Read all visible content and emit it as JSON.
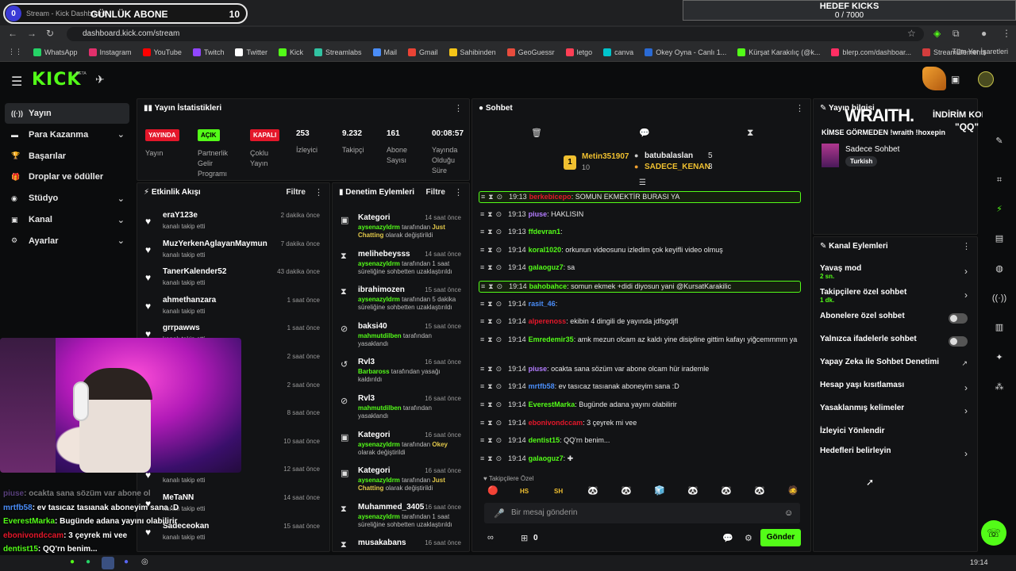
{
  "overlay": {
    "goal_count_left": "0",
    "goal_title": "GÜNLÜK ABONE",
    "goal_count": "10",
    "browser_tab": "Stream - Kick Dashboard",
    "kicks_title": "HEDEF KICKS",
    "kicks_value": "0 / 7000",
    "sponsor_brand": "WRAITH.",
    "sponsor_discount": "İNDİRİM KODU",
    "sponsor_code": "\"QQ\"",
    "sponsor_line": "KİMSE GÖRMEDEN !wraith !hoxepin"
  },
  "browser": {
    "url": "dashboard.kick.com/stream",
    "bookmarks": [
      "WhatsApp",
      "Instagram",
      "YouTube",
      "Twitch",
      "Twitter",
      "Kick",
      "Streamlabs",
      "Mail",
      "Gmail",
      "Sahibinden",
      "GeoGuessr",
      "letgo",
      "canva",
      "Okey Oyna - Canlı 1...",
      "Kürşat Karakılıç (@k...",
      "blerp.com/dashboar...",
      "StreamElements"
    ],
    "bookmarks_right": "Tüm Yer İşaretleri",
    "bookmark_colors": [
      "#25d366",
      "#e1306c",
      "#ff0000",
      "#9146ff",
      "#ffffff",
      "#53fc18",
      "#31c3a2",
      "#4a8df8",
      "#ea4335",
      "#f5c518",
      "#e84c3d",
      "#ff3f55",
      "#00c4cc",
      "#2a6ad4",
      "#53fc18",
      "#ff2e63",
      "#d43d3d"
    ]
  },
  "header": {
    "logo": "KICK",
    "beta": "BETA"
  },
  "sidebar": {
    "items": [
      {
        "label": "Yayın",
        "icon": "broadcast-icon",
        "glyph": "((·))",
        "chevron": ""
      },
      {
        "label": "Para Kazanma",
        "icon": "money-icon",
        "glyph": "▬",
        "chevron": "⌄"
      },
      {
        "label": "Başarılar",
        "icon": "trophy-icon",
        "glyph": "🏆",
        "chevron": ""
      },
      {
        "label": "Droplar ve ödüller",
        "icon": "gift-icon",
        "glyph": "🎁",
        "chevron": ""
      },
      {
        "label": "Stüdyo",
        "icon": "studio-icon",
        "glyph": "◉",
        "chevron": "⌄"
      },
      {
        "label": "Kanal",
        "icon": "channel-icon",
        "glyph": "▣",
        "chevron": "⌄"
      },
      {
        "label": "Ayarlar",
        "icon": "gear-icon",
        "glyph": "⚙",
        "chevron": "⌄"
      }
    ]
  },
  "stats": {
    "title": "Yayın İstatistikleri",
    "badges": [
      "YAYINDA",
      "AÇIK",
      "KAPALI"
    ],
    "badge_labels": [
      "Yayın",
      "Partnerlik\nGelir\nProgramı",
      "Çoklu\nYayın"
    ],
    "values": [
      "253",
      "9.232",
      "161",
      "00:08:57"
    ],
    "value_labels": [
      "İzleyici",
      "Takipçi",
      "Abone\nSayısı",
      "Yayında\nOlduğu\nSüre"
    ],
    "colors": {
      "red": "#e4172a",
      "green": "#53fc18"
    }
  },
  "activity": {
    "title": "Etkinlik Akışı",
    "filter": "Filtre",
    "rows": [
      {
        "name": "eraY123e",
        "sub": "kanalı takip etti",
        "time": "2 dakika önce"
      },
      {
        "name": "MuzYerkenAglayanMaymun",
        "sub": "kanalı takip etti",
        "time": "7 dakika önce"
      },
      {
        "name": "TanerKalender52",
        "sub": "kanalı takip etti",
        "time": "43 dakika önce"
      },
      {
        "name": "ahmethanzara",
        "sub": "kanalı takip etti",
        "time": "1 saat önce"
      },
      {
        "name": "grrpawws",
        "sub": "kanalı takip etti",
        "time": "1 saat önce"
      },
      {
        "name": "",
        "sub": "",
        "time": "2 saat önce"
      },
      {
        "name": "",
        "sub": "",
        "time": "2 saat önce"
      },
      {
        "name": "",
        "sub": "",
        "time": "8 saat önce"
      },
      {
        "name": "",
        "sub": "",
        "time": "10 saat önce"
      },
      {
        "name": "",
        "sub": "kanalı takip etti",
        "time": "12 saat önce"
      },
      {
        "name": "MeTaNN",
        "sub": "kanalı takip etti",
        "time": "14 saat önce"
      },
      {
        "name": "Sadeceokan",
        "sub": "kanalı takip etti",
        "time": "15 saat önce"
      }
    ]
  },
  "moderation": {
    "title": "Denetim Eylemleri",
    "filter": "Filtre",
    "rows": [
      {
        "name": "Kategori",
        "time": "14 saat önce",
        "icon": "category-icon",
        "glyph": "▣",
        "actor": "aysenazyldrm",
        "mid": " tarafından ",
        "highlight": "Just Chatting",
        "rest": " olarak değiştirildi",
        "hl_class": "y"
      },
      {
        "name": "melihebeysss",
        "time": "14 saat önce",
        "icon": "timeout-icon",
        "glyph": "⧗",
        "actor": "aysenazyldrm",
        "mid": " tarafından 1 saat süreliğine sohbetten uzaklaştırıldı",
        "highlight": "",
        "rest": "",
        "hl_class": ""
      },
      {
        "name": "ibrahimozen",
        "time": "15 saat önce",
        "icon": "timeout-icon",
        "glyph": "⧗",
        "actor": "aysenazyldrm",
        "mid": " tarafından 5 dakika süreliğine sohbetten uzaklaştırıldı",
        "highlight": "",
        "rest": "",
        "hl_class": ""
      },
      {
        "name": "baksi40",
        "time": "15 saat önce",
        "icon": "ban-icon",
        "glyph": "⊘",
        "actor": "mahmutdilben",
        "mid": " tarafından yasaklandı",
        "highlight": "",
        "rest": "",
        "hl_class": ""
      },
      {
        "name": "Rvl3",
        "time": "16 saat önce",
        "icon": "unban-icon",
        "glyph": "↺",
        "actor": "Barbaross",
        "mid": " tarafından yasağı kaldırıldı",
        "highlight": "",
        "rest": "",
        "hl_class": ""
      },
      {
        "name": "Rvl3",
        "time": "16 saat önce",
        "icon": "ban-icon",
        "glyph": "⊘",
        "actor": "mahmutdilben",
        "mid": " tarafından yasaklandı",
        "highlight": "",
        "rest": "",
        "hl_class": ""
      },
      {
        "name": "Kategori",
        "time": "16 saat önce",
        "icon": "category-icon",
        "glyph": "▣",
        "actor": "aysenazyldrm",
        "mid": " tarafından ",
        "highlight": "Okey",
        "rest": " olarak değiştirildi",
        "hl_class": "y"
      },
      {
        "name": "Kategori",
        "time": "16 saat önce",
        "icon": "category-icon",
        "glyph": "▣",
        "actor": "aysenazyldrm",
        "mid": " tarafından ",
        "highlight": "Just Chatting",
        "rest": " olarak değiştirildi",
        "hl_class": "y"
      },
      {
        "name": "Muhammed_3405",
        "time": "16 saat önce",
        "icon": "timeout-icon",
        "glyph": "⧗",
        "actor": "aysenazyldrm",
        "mid": " tarafından 1 saat süreliğine sohbetten uzaklaştırıldı",
        "highlight": "",
        "rest": "",
        "hl_class": ""
      },
      {
        "name": "musakabans",
        "time": "16 saat önce",
        "icon": "timeout-icon",
        "glyph": "⧗",
        "actor": "",
        "mid": "",
        "highlight": "",
        "rest": "",
        "hl_class": ""
      }
    ]
  },
  "chat": {
    "title": "Sohbet",
    "leader1": {
      "name": "Metin351907",
      "value": "10"
    },
    "leaders": [
      {
        "name": "batubalaslan",
        "value": "5"
      },
      {
        "name": "SADECE_KENAN",
        "value": "3"
      }
    ],
    "messages": [
      {
        "time": "19:13",
        "user": "berkebicepo",
        "color": "#e4172a",
        "text": ": SOMUN EKMEKTİR BURASI YA",
        "hl": true
      },
      {
        "time": "19:13",
        "user": "piuse",
        "color": "#b37cff",
        "text": ": HAKLISIN",
        "hl": false
      },
      {
        "time": "19:13",
        "user": "ffdevran1",
        "color": "#53fc18",
        "text": ":",
        "hl": false
      },
      {
        "time": "19:14",
        "user": "koral1020",
        "color": "#53fc18",
        "text": ": orkunun videosunu izledim çok keyifli video olmuş",
        "hl": false
      },
      {
        "time": "19:14",
        "user": "galaoguz7",
        "color": "#53fc18",
        "text": ": sa",
        "hl": false
      },
      {
        "time": "19:14",
        "user": "bahobahce",
        "color": "#53fc18",
        "text": ": somun ekmek +didi diyosun yani @KursatKarakilic",
        "hl": true
      },
      {
        "time": "19:14",
        "user": "rasit_46",
        "color": "#4a8df8",
        "text": ":",
        "hl": false
      },
      {
        "time": "19:14",
        "user": "alperenoss",
        "color": "#e4172a",
        "text": ": ekibin 4 dingili de yayında jdfsgdjfl",
        "hl": false
      },
      {
        "time": "19:14",
        "user": "Emredemir35",
        "color": "#53fc18",
        "text": ": amk mezun olcam az kaldı yine disipline gittim kafayı yiğcemmmm ya",
        "hl": false
      },
      {
        "time": "19:14",
        "user": "piuse",
        "color": "#b37cff",
        "text": ": ocakta sana sözüm var abone olcam hür irademle",
        "hl": false
      },
      {
        "time": "19:14",
        "user": "mrtfb58",
        "color": "#4a8df8",
        "text": ": ev tasıcaz tasıanak aboneyim sana :D",
        "hl": false
      },
      {
        "time": "19:14",
        "user": "EverestMarka",
        "color": "#53fc18",
        "text": ": Bugünde adana yayını olabilirir",
        "hl": false
      },
      {
        "time": "19:14",
        "user": "ebonivondccam",
        "color": "#e4172a",
        "text": ": 3 çeyrek mi vee",
        "hl": false
      },
      {
        "time": "19:14",
        "user": "dentist15",
        "color": "#53fc18",
        "text": ": QQ'rn benim...",
        "hl": false
      },
      {
        "time": "19:14",
        "user": "galaoguz7",
        "color": "#53fc18",
        "text": ": ✚",
        "hl": false
      }
    ],
    "emote_label": "Takipçilere Özel",
    "emotes": [
      "🔴",
      "HS",
      "SH",
      "🐼",
      "🐼",
      "🧊",
      "🐼",
      "🐼",
      "🐼",
      "🧔"
    ],
    "placeholder": "Bir mesaj gönderin",
    "kick_count": "0",
    "send": "Gönder"
  },
  "stream_info": {
    "title": "Yayın bilgisi",
    "category": "Sadece Sohbet",
    "language": "Turkish"
  },
  "channel_actions": {
    "title": "Kanal Eylemleri",
    "rows": [
      {
        "label": "Yavaş mod",
        "sub": "2 sn.",
        "ctrl": "arrow"
      },
      {
        "label": "Takipçilere özel sohbet",
        "sub": "1 dk.",
        "ctrl": "arrow"
      },
      {
        "label": "Abonelere özel sohbet",
        "sub": "",
        "ctrl": "toggle"
      },
      {
        "label": "Yalnızca ifadelerle sohbet",
        "sub": "",
        "ctrl": "toggle"
      },
      {
        "label": "Yapay Zeka ile Sohbet Denetimi",
        "sub": "",
        "ctrl": "link"
      },
      {
        "label": "Hesap yaşı kısıtlaması",
        "sub": "",
        "ctrl": "arrow"
      },
      {
        "label": "Yasaklanmış kelimeler",
        "sub": "",
        "ctrl": "arrow"
      },
      {
        "label": "İzleyici Yönlendir",
        "sub": "",
        "ctrl": ""
      },
      {
        "label": "Hedefleri belirleyin",
        "sub": "",
        "ctrl": "arrow"
      }
    ]
  },
  "overlay_chat": [
    {
      "user": "piuse",
      "text": ": ocakta sana sözüm var abone ol",
      "color": "#b37cff"
    },
    {
      "user": "mrtfb58",
      "text": ": ev tasıcaz tasıanak aboneyim sana :D",
      "color": "#4a8df8"
    },
    {
      "user": "EverestMarka",
      "text": ": Bugünde adana yayını olabilirir",
      "color": "#53fc18"
    },
    {
      "user": "ebonivondccam",
      "text": ": 3 çeyrek mi vee",
      "color": "#e4172a"
    },
    {
      "user": "dentist15",
      "text": ": QQ'rn benim...",
      "color": "#53fc18"
    },
    {
      "user": "galaoguz7",
      "text": "",
      "color": "#53fc18"
    }
  ],
  "taskbar": {
    "time": "19:14"
  }
}
